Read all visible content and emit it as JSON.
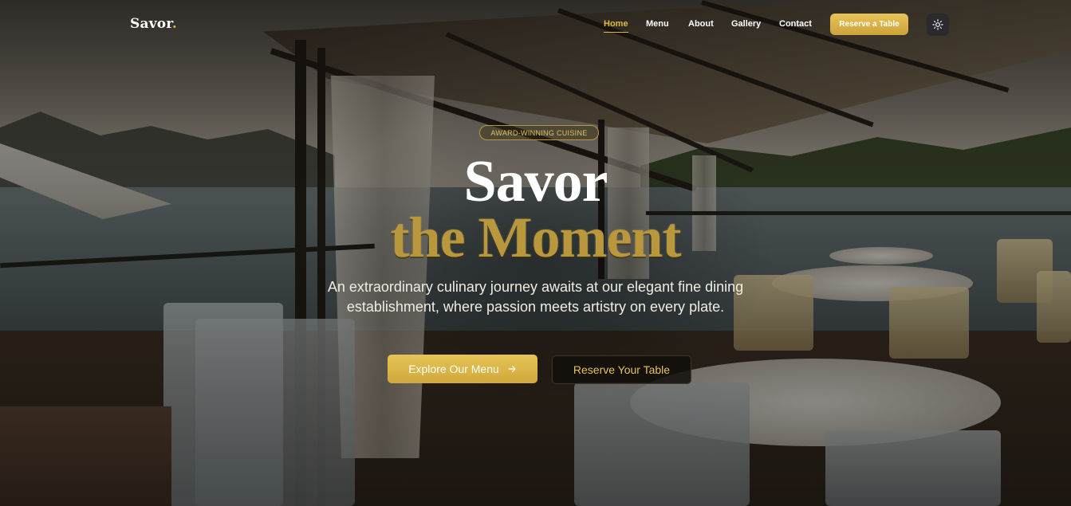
{
  "brand": {
    "name": "Savor",
    "dot": ".",
    "accent_color": "#d9b54a"
  },
  "nav": {
    "links": [
      "Home",
      "Menu",
      "About",
      "Gallery",
      "Contact"
    ],
    "active": "Home",
    "reserve_label": "Reserve a Table",
    "theme_icon": "sun-icon"
  },
  "hero": {
    "badge": "AWARD-WINNING CUISINE",
    "title_line1": "Savor",
    "title_line2": "the Moment",
    "subtitle": "An extraordinary culinary journey awaits at our elegant fine dining establishment, where passion meets artistry on every plate.",
    "primary_button": "Explore Our Menu",
    "primary_icon": "arrow-right-icon",
    "secondary_button": "Reserve Your Table"
  },
  "colors": {
    "gold": "#d9b54a",
    "button_gold": "#e0b84a",
    "dark_button": "#120e0a"
  }
}
